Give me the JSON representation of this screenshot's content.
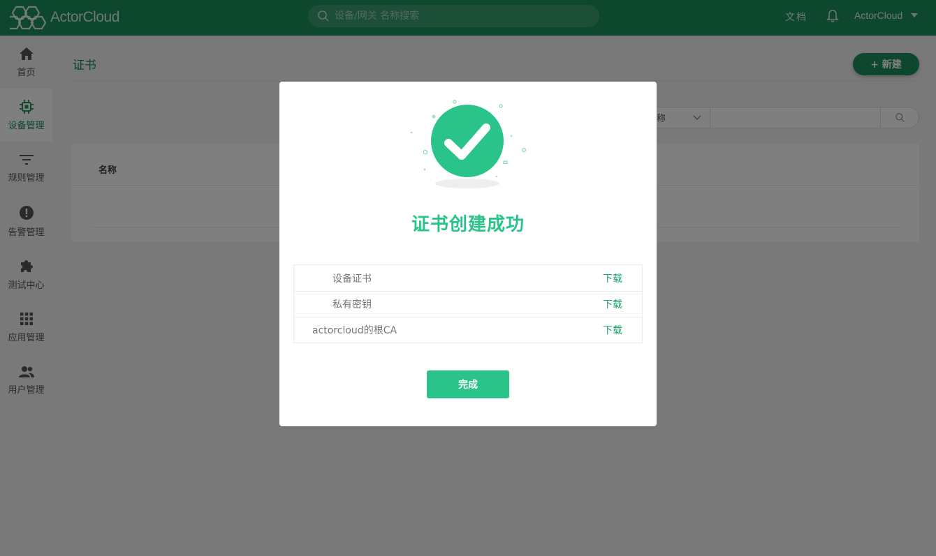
{
  "app": {
    "brand": "ActorCloud",
    "search_placeholder": "设备/网关 名称搜索",
    "docs_label": "文档",
    "user_name": "ActorCloud",
    "accent_color": "#1a8f5a"
  },
  "sidebar": {
    "items": [
      {
        "label": "首页",
        "icon": "home-icon"
      },
      {
        "label": "设备管理",
        "icon": "chip-icon",
        "active": true
      },
      {
        "label": "规则管理",
        "icon": "filter-icon"
      },
      {
        "label": "告警管理",
        "icon": "alert-icon"
      },
      {
        "label": "测试中心",
        "icon": "puzzle-icon"
      },
      {
        "label": "应用管理",
        "icon": "grid-icon"
      },
      {
        "label": "用户管理",
        "icon": "users-icon"
      }
    ]
  },
  "page": {
    "title": "证书",
    "new_button": "+ 新建",
    "filter_select": "称",
    "table_header_name": "名称"
  },
  "modal": {
    "title": "证书创建成功",
    "rows": [
      {
        "name": "设备证书",
        "action": "下载"
      },
      {
        "name": "私有密钥",
        "action": "下载"
      },
      {
        "name": "actorcloud的根CA",
        "action": "下载"
      }
    ],
    "done_button": "完成",
    "success_color": "#2ac48a"
  }
}
